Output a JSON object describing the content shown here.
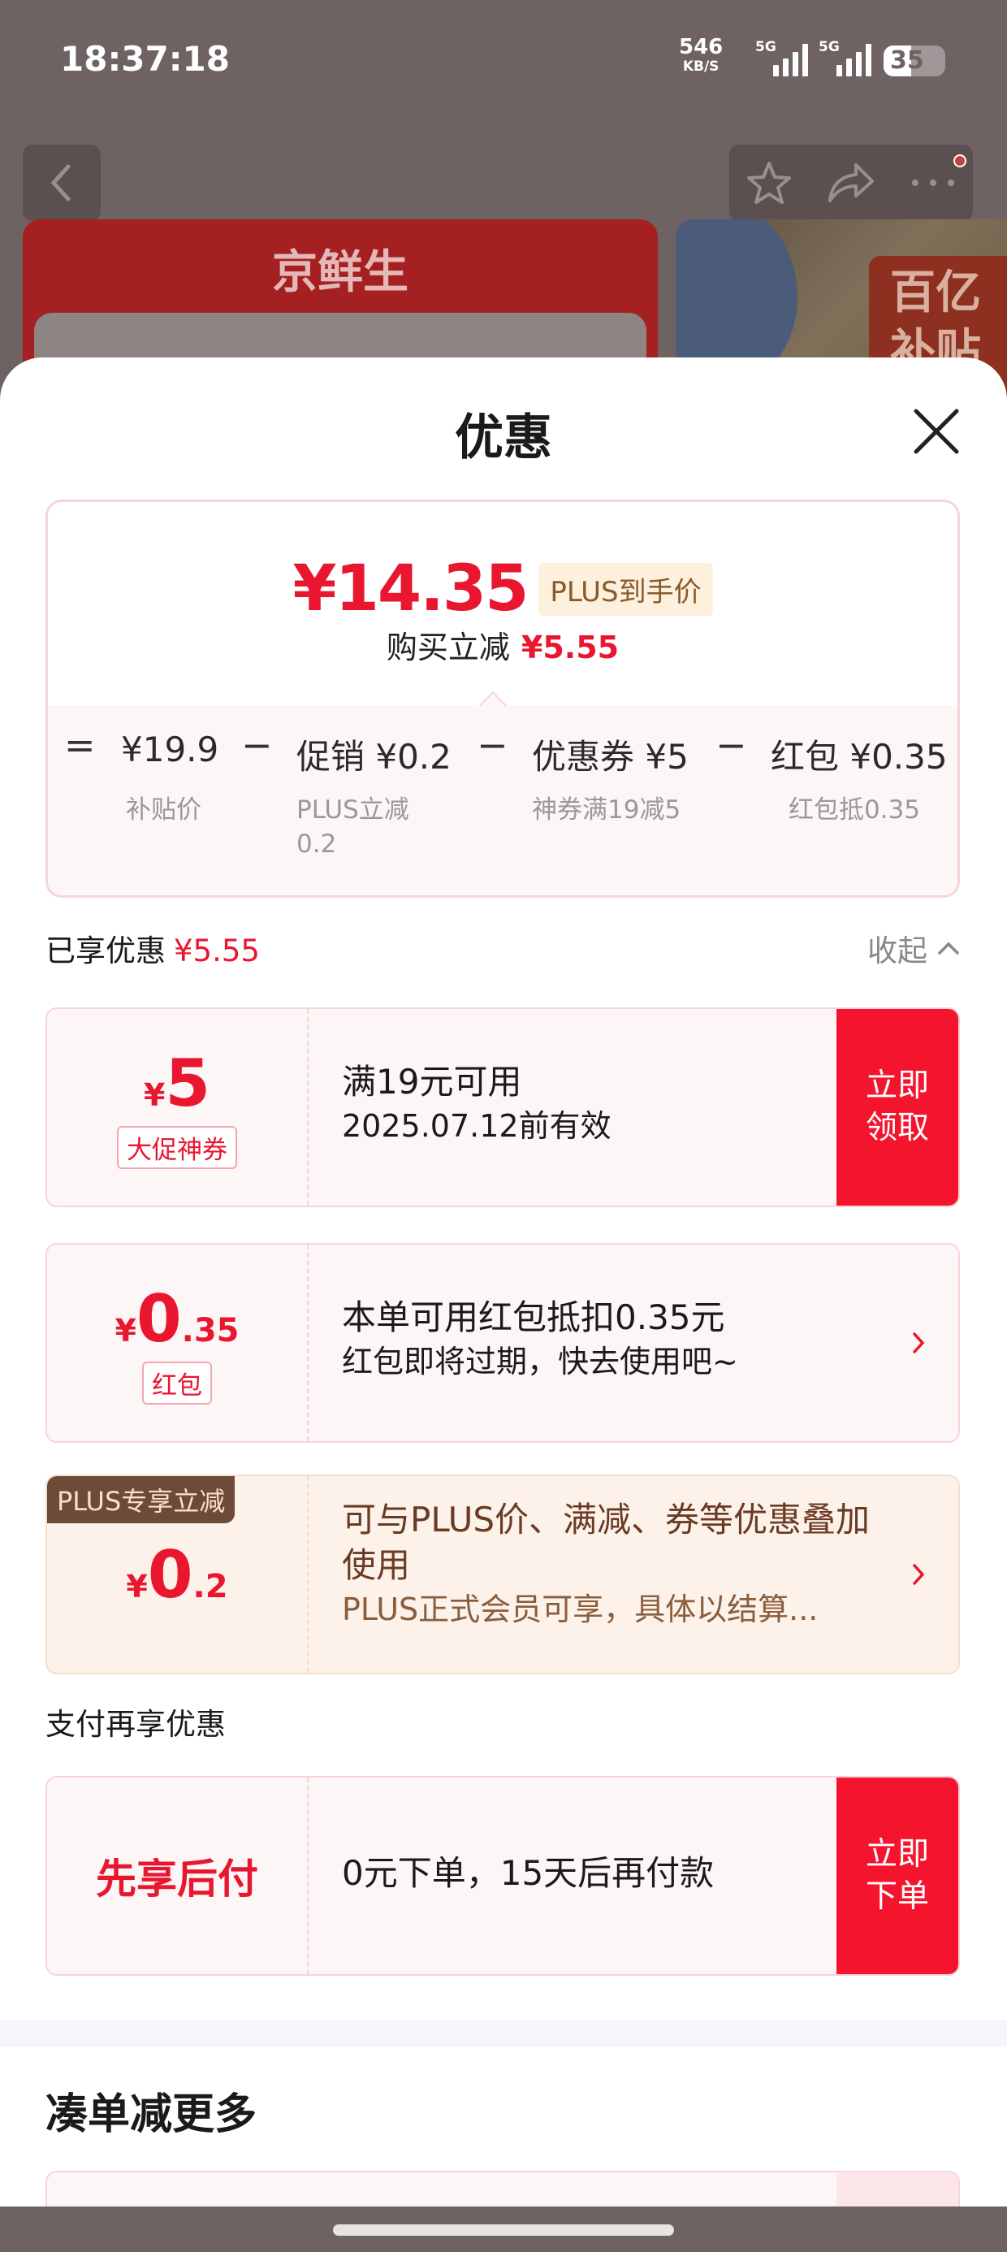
{
  "status_bar": {
    "time": "18:37:18",
    "speed": "546",
    "speed_unit": "KB/S",
    "network": "5G",
    "network2": "5G",
    "battery": "35"
  },
  "background": {
    "store_name": "京鲜生",
    "promo_tag": "百亿\n补贴"
  },
  "sheet": {
    "title": "优惠",
    "summary": {
      "final_price": "¥14.35",
      "price_badge": "PLUS到手价",
      "reduce_label": "购买立减",
      "reduce_amount": "¥5.55",
      "breakdown": [
        {
          "op": "=",
          "label": "¥19.9",
          "sub": "补贴价"
        },
        {
          "op": "−",
          "label": "促销 ¥0.2",
          "sub": "PLUS立减\n0.2"
        },
        {
          "op": "−",
          "label": "优惠券 ¥5",
          "sub": "神券满19减5"
        },
        {
          "op": "−",
          "label": "红包 ¥0.35",
          "sub": "红包抵0.35"
        }
      ]
    },
    "enjoyed": {
      "label": "已享优惠",
      "amount": "¥5.55",
      "collapse": "收起"
    },
    "coupons": [
      {
        "currency": "¥",
        "amount": "5",
        "decimal": "",
        "tag": "大促神券",
        "title": "满19元可用",
        "sub": "2025.07.12前有效",
        "button": "立即\n领取"
      },
      {
        "currency": "¥",
        "amount": "0",
        "decimal": ".35",
        "tag": "红包",
        "title": "本单可用红包抵扣0.35元",
        "sub": "红包即将过期，快去使用吧~"
      },
      {
        "corner": "PLUS专享立减",
        "currency": "¥",
        "amount": "0",
        "decimal": ".2",
        "title": "可与PLUS价、满减、券等优惠叠加使用",
        "sub": "PLUS正式会员可享，具体以结算..."
      }
    ],
    "pay_section": {
      "title": "支付再享优惠",
      "card_label": "先享后付",
      "card_text": "0元下单，15天后再付款",
      "button": "立即\n下单"
    },
    "more_title": "凑单减更多"
  },
  "colors": {
    "accent_red": "#e9162f",
    "button_red": "#f5142e",
    "plus_brown": "#6e4a38"
  }
}
